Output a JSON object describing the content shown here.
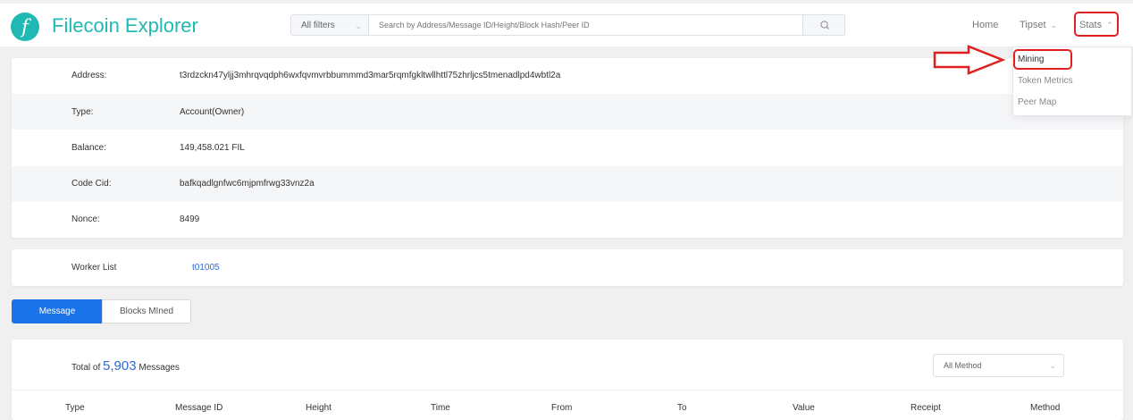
{
  "brand": {
    "logo_glyph": "f",
    "name": "Filecoin Explorer",
    "color": "#21b9b3"
  },
  "search": {
    "filter_label": "All filters",
    "placeholder": "Search by Address/Message ID/Height/Block Hash/Peer ID"
  },
  "nav": {
    "home": "Home",
    "tipset": "Tipset",
    "stats": "Stats"
  },
  "stats_menu": {
    "items": [
      "Mining",
      "Token Metrics",
      "Peer Map"
    ]
  },
  "account": {
    "fields": [
      {
        "label": "Address:",
        "value": "t3rdzckn47yljj3mhrqvqdph6wxfqvmvrbbummmd3mar5rqmfgkltwllhttl75zhrljcs5tmenadlpd4wbtl2a"
      },
      {
        "label": "Type:",
        "value": "Account(Owner)"
      },
      {
        "label": "Balance:",
        "value": "149,458.021 FIL"
      },
      {
        "label": "Code Cid:",
        "value": "bafkqadlgnfwc6mjpmfrwg33vnz2a"
      },
      {
        "label": "Nonce:",
        "value": "8499"
      }
    ]
  },
  "workers": {
    "label": "Worker List",
    "value": "t01005"
  },
  "tabs": {
    "message": "Message",
    "blocks_mined": "Blocks MIned"
  },
  "messages": {
    "total_prefix": "Total of",
    "total_count": "5,903",
    "total_suffix": "Messages",
    "method_filter": "All Method",
    "columns": [
      "Type",
      "Message ID",
      "Height",
      "Time",
      "From",
      "To",
      "Value",
      "Receipt",
      "Method"
    ]
  },
  "annotation_color": "#e02020"
}
